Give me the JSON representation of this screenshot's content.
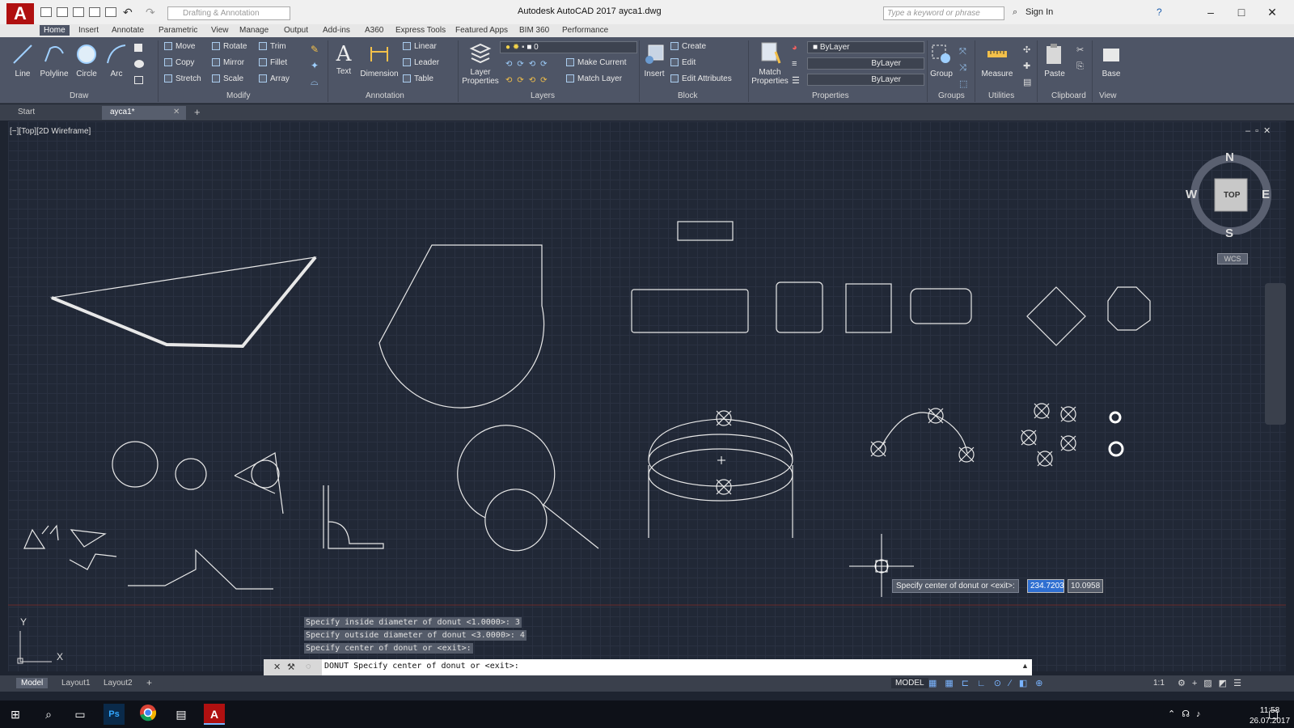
{
  "app": {
    "title": "Autodesk AutoCAD 2017",
    "file": "ayca1.dwg",
    "logo": "A",
    "workspace": "Drafting & Annotation",
    "search_placeholder": "Type a keyword or phrase",
    "signin": "Sign In"
  },
  "ribbon_tabs": [
    "Home",
    "Insert",
    "Annotate",
    "Parametric",
    "View",
    "Manage",
    "Output",
    "Add-ins",
    "A360",
    "Express Tools",
    "Featured Apps",
    "BIM 360",
    "Performance"
  ],
  "draw": {
    "line": "Line",
    "polyline": "Polyline",
    "circle": "Circle",
    "arc": "Arc",
    "label": "Draw"
  },
  "modify": {
    "move": "Move",
    "rotate": "Rotate",
    "trim": "Trim",
    "copy": "Copy",
    "mirror": "Mirror",
    "fillet": "Fillet",
    "stretch": "Stretch",
    "scale": "Scale",
    "array": "Array",
    "label": "Modify"
  },
  "annotation": {
    "text": "Text",
    "dimension": "Dimension",
    "linear": "Linear",
    "leader": "Leader",
    "table": "Table",
    "label": "Annotation"
  },
  "layers": {
    "props1": "Layer",
    "props2": "Properties",
    "current_layer": "0",
    "make_current": "Make Current",
    "match_layer": "Match Layer",
    "label": "Layers"
  },
  "block": {
    "insert": "Insert",
    "create": "Create",
    "edit": "Edit",
    "edit_attributes": "Edit Attributes",
    "label": "Block"
  },
  "properties": {
    "match1": "Match",
    "match2": "Properties",
    "color": "ByLayer",
    "linetype": "ByLayer",
    "lineweight": "ByLayer",
    "label": "Properties"
  },
  "groups": {
    "group": "Group",
    "label": "Groups"
  },
  "utilities": {
    "measure": "Measure",
    "label": "Utilities"
  },
  "clipboard": {
    "paste": "Paste",
    "label": "Clipboard"
  },
  "view": {
    "base": "Base",
    "label": "View"
  },
  "file_tabs": [
    "Start",
    "ayca1*"
  ],
  "viewport_label": "[−][Top][2D Wireframe]",
  "viewcube": {
    "n": "N",
    "s": "S",
    "e": "E",
    "w": "W",
    "top": "TOP",
    "wcs": "WCS"
  },
  "ucs": {
    "x": "X",
    "y": "Y"
  },
  "command_history": [
    "Specify inside diameter of donut <1.0000>: 3",
    "Specify outside diameter of donut <3.0000>: 4",
    "Specify center of donut or <exit>:"
  ],
  "command_line": "DONUT Specify center of donut or <exit>:",
  "tooltip": {
    "prompt": "Specify center of donut or <exit>:",
    "x": "234.7203",
    "y": "10.0958"
  },
  "layout_tabs": [
    "Model",
    "Layout1",
    "Layout2"
  ],
  "status": {
    "model": "MODEL",
    "scale": "1:1"
  },
  "clock": {
    "time": "11:58",
    "date": "26.07.2017"
  },
  "taskbar_apps": [
    "Ps",
    "A"
  ],
  "icons": {
    "logo": "autocad-a-icon",
    "start": "windows-start-icon",
    "search": "search-icon",
    "chrome": "chrome-icon"
  }
}
